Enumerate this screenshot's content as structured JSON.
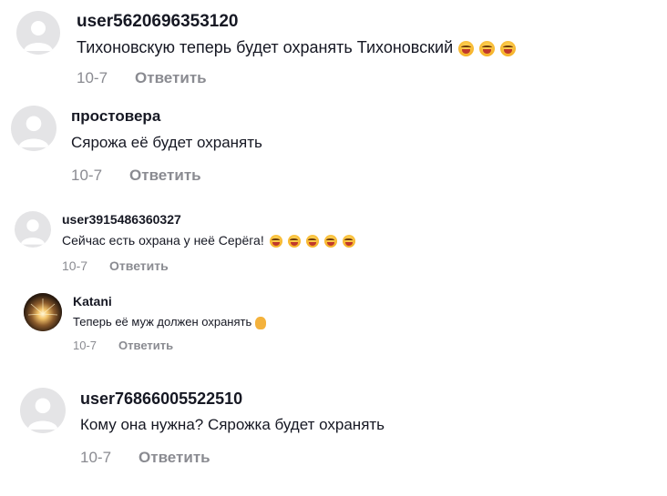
{
  "comments": [
    {
      "username": "user5620696353120",
      "text": "Тихоновскую теперь будет охранять Тихоновский",
      "emoji_count": 3,
      "date": "10-7",
      "reply_label": "Ответить"
    },
    {
      "username": "простовера",
      "text": "Сярожа её будет охранять",
      "date": "10-7",
      "reply_label": "Ответить"
    },
    {
      "username": "user3915486360327",
      "text": "Сейчас есть охрана у неё Серёга!",
      "emoji_count": 5,
      "date": "10-7",
      "reply_label": "Ответить"
    },
    {
      "username": "Katani",
      "text": "Теперь её муж должен охранять",
      "emoji": "hand-icon",
      "date": "10-7",
      "reply_label": "Ответить"
    },
    {
      "username": "user76866005522510",
      "text": "Кому она нужна? Сярожка будет охранять",
      "date": "10-7",
      "reply_label": "Ответить"
    }
  ],
  "colors": {
    "text": "#161823",
    "muted": "#8a8b91",
    "avatar_bg": "#e4e4e6",
    "emoji": "#f6b42a"
  }
}
